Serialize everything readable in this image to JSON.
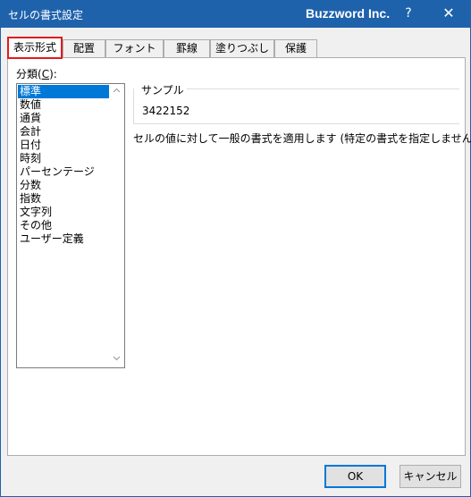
{
  "window": {
    "title": "セルの書式設定",
    "brand": "Buzzword Inc.",
    "help_glyph": "?",
    "close_glyph": "✕"
  },
  "tabs": [
    {
      "label": "表示形式",
      "active": true
    },
    {
      "label": "配置",
      "active": false
    },
    {
      "label": "フォント",
      "active": false
    },
    {
      "label": "罫線",
      "active": false
    },
    {
      "label": "塗りつぶし",
      "active": false
    },
    {
      "label": "保護",
      "active": false
    }
  ],
  "category": {
    "label_prefix": "分類(",
    "label_key": "C",
    "label_suffix": "):",
    "items": [
      "標準",
      "数値",
      "通貨",
      "会計",
      "日付",
      "時刻",
      "パーセンテージ",
      "分数",
      "指数",
      "文字列",
      "その他",
      "ユーザー定義"
    ],
    "selected": "標準"
  },
  "sample": {
    "label": "サンプル",
    "value": "3422152"
  },
  "description": "セルの値に対して一般の書式を適用します (特定の書式を指定しません)。",
  "buttons": {
    "ok": "OK",
    "cancel": "キャンセル"
  },
  "colors": {
    "titlebar": "#1f62ac",
    "selection": "#0078d7",
    "highlight_border": "#e01b1b"
  },
  "icons": {
    "scroll_up": "chevron-up-icon",
    "scroll_down": "chevron-down-icon"
  }
}
